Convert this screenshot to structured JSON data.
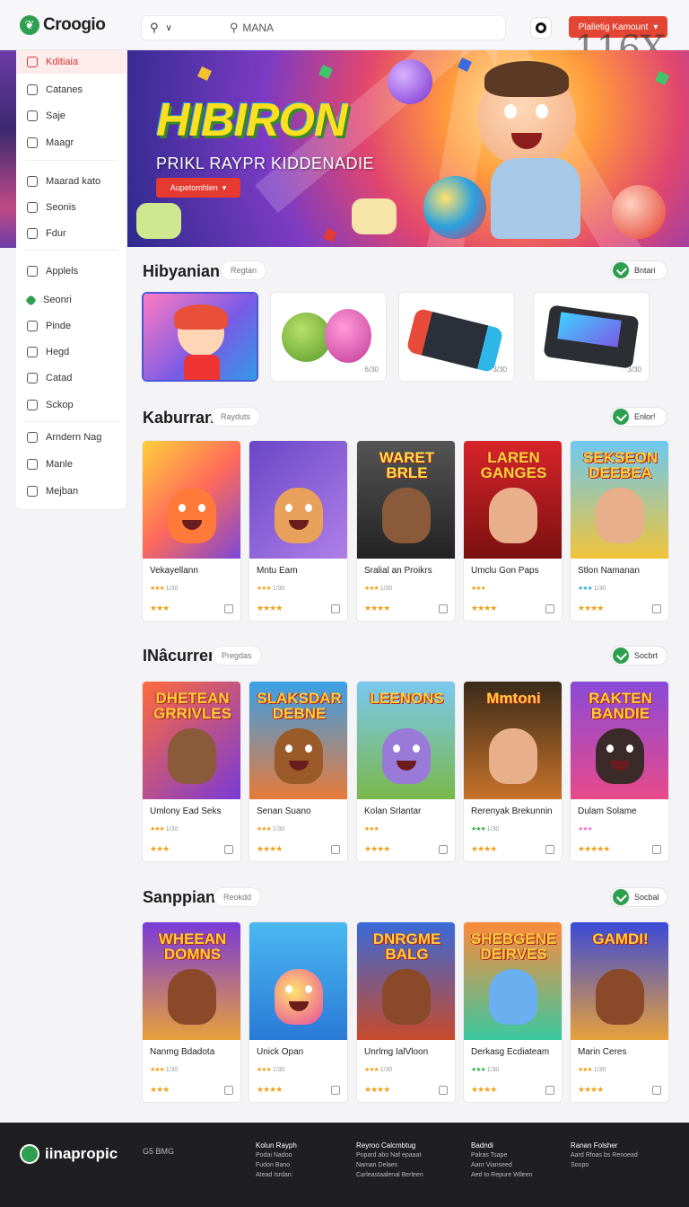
{
  "brand": {
    "name": "Croogio"
  },
  "search": {
    "value": "MANA"
  },
  "header": {
    "cta_label": "Plalletig Kamount",
    "watermark": "116X"
  },
  "sidebar": {
    "items": [
      {
        "label": "Kditiaia"
      },
      {
        "label": "Catanes"
      },
      {
        "label": "Saje"
      },
      {
        "label": "Maagr"
      },
      {
        "label": "Maarad kato"
      },
      {
        "label": "Seonis"
      },
      {
        "label": "Fdur"
      },
      {
        "label": "Applels"
      },
      {
        "label": "Seonri"
      },
      {
        "label": "Pinde"
      },
      {
        "label": "Hegd"
      },
      {
        "label": "Catad"
      },
      {
        "label": "Sckop"
      },
      {
        "label": "Arndern Nag"
      },
      {
        "label": "Manle"
      },
      {
        "label": "Mejban"
      }
    ]
  },
  "hero": {
    "title": "HIBIRON",
    "subtitle": "PRIKL RAYPR KIDDENADIE",
    "button_label": "Aupetomhlen"
  },
  "featured": {
    "title": "Hibyanian",
    "tag": "Regtan",
    "button": "Bntari",
    "tiles": [
      {
        "price": ""
      },
      {
        "price": "6/30"
      },
      {
        "price": "3/30"
      },
      {
        "price": "3/30"
      }
    ]
  },
  "sections": [
    {
      "title": "Kaburran",
      "tag": "Rayduts",
      "button": "Enlor!",
      "cards": [
        {
          "art_title": "",
          "name": "Vekayellann",
          "meta": "1/30"
        },
        {
          "art_title": "",
          "name": "Mntu Eam",
          "meta": "1/30"
        },
        {
          "art_title": "WARET BRLE",
          "name": "Sralial an Proikrs",
          "meta": "1/30"
        },
        {
          "art_title": "LAREN GANGES",
          "name": "Umclu Gon Paps",
          "meta": ""
        },
        {
          "art_title": "SEKSEON DEEBEA",
          "name": "Stlon Namanan",
          "meta": "1/30"
        }
      ]
    },
    {
      "title": "INâcurren",
      "tag": "Pregdas",
      "button": "Socbrt",
      "cards": [
        {
          "art_title": "DHETEAN GRRIVLES",
          "name": "Umlony Ead Seks",
          "meta": "1/30"
        },
        {
          "art_title": "SLAKSDAR DEBNE",
          "name": "Senan Suano",
          "meta": "1/30"
        },
        {
          "art_title": "LEENONS",
          "name": "Kolan Srlantar",
          "meta": ""
        },
        {
          "art_title": "Mmtoni",
          "name": "Rerenyak Brekunnin",
          "meta": "1/30"
        },
        {
          "art_title": "RAKTEN BANDIE",
          "name": "Dulam Solame",
          "meta": ""
        }
      ]
    },
    {
      "title": "Sanppian",
      "tag": "Reokdd",
      "button": "Socbal",
      "cards": [
        {
          "art_title": "WHEEAN DOMNS",
          "name": "Nanmg Bdadota",
          "meta": "1/30"
        },
        {
          "art_title": "",
          "name": "Unick Opan",
          "meta": "1/30"
        },
        {
          "art_title": "DNRGME BALG",
          "name": "Unrlmg IalVloon",
          "meta": "1/30"
        },
        {
          "art_title": "SHEBGENE DEIRVES",
          "name": "Derkasg Ecdiateam",
          "meta": "1/30"
        },
        {
          "art_title": "GAMDI!",
          "name": "Marin Ceres",
          "meta": "1/30"
        }
      ]
    }
  ],
  "footer": {
    "brand": "iinapropic",
    "copy": "G5 BMG",
    "columns": [
      {
        "heading": "Kolun Rayph",
        "lines": [
          "Podai Nadoo",
          "Fudon Bano",
          "Atead Isrdan:"
        ]
      },
      {
        "heading": "Reyroo Calcmbtug",
        "lines": [
          "Popard abo Naf epaaat",
          "Naman Delaex",
          "Carleastaalenal Berleen"
        ]
      },
      {
        "heading": "Badndi",
        "lines": [
          "Palras Tsape",
          "Aanr Vianseed",
          "Aed to Repure Wileen"
        ]
      },
      {
        "heading": "Ranan Folsher",
        "lines": [
          "Aard Rfoas bs Renoead",
          "Soopo"
        ]
      }
    ]
  },
  "colors": {
    "accent": "#e24533",
    "brand_green": "#2e9e4f"
  },
  "icons": [
    "search-icon",
    "chevron-down-icon",
    "bell-icon",
    "check-icon",
    "star-icon"
  ]
}
